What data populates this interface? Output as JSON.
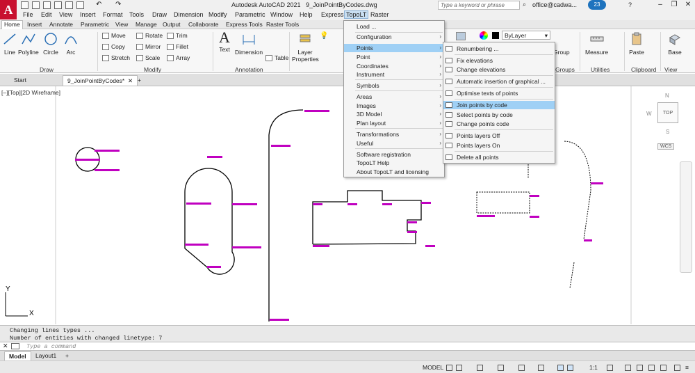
{
  "titlebar": {
    "app_title": "Autodesk AutoCAD 2021",
    "file_title": "9_JoinPointByCodes.dwg",
    "search_placeholder": "Type a keyword or phrase",
    "user": "office@cadwa...",
    "timer": "23",
    "logo_letter": "A"
  },
  "menubar": [
    "File",
    "Edit",
    "View",
    "Insert",
    "Format",
    "Tools",
    "Draw",
    "Dimension",
    "Modify",
    "Parametric",
    "Window",
    "Help",
    "Express",
    "TopoLT",
    "Raster"
  ],
  "ribbon_tabs": [
    "Home",
    "Insert",
    "Annotate",
    "Parametric",
    "View",
    "Manage",
    "Output",
    "Collaborate",
    "Express Tools",
    "Raster Tools"
  ],
  "ribbon": {
    "draw": {
      "title": "Draw",
      "buttons": [
        "Line",
        "Polyline",
        "Circle",
        "Arc"
      ]
    },
    "modify": {
      "title": "Modify",
      "buttons": [
        "Move",
        "Rotate",
        "Trim",
        "Copy",
        "Mirror",
        "Fillet",
        "Stretch",
        "Scale",
        "Array"
      ]
    },
    "annotation": {
      "title": "Annotation",
      "buttons": [
        "Text",
        "Dimension",
        "Table"
      ]
    },
    "layers": {
      "title": "Layer Properties",
      "bylayer": "ByLayer"
    },
    "groups": {
      "title": "Groups",
      "button": "Group"
    },
    "utilities": {
      "title": "Utilities",
      "button": "Measure"
    },
    "clipboard": {
      "title": "Clipboard",
      "button": "Paste"
    },
    "view": {
      "title": "View",
      "button": "Base"
    }
  },
  "doc_tabs": [
    "Start",
    "9_JoinPointByCodes*"
  ],
  "viewport_label": "[–][Top][2D Wireframe]",
  "viewcube": {
    "top": "TOP",
    "n": "N",
    "s": "S",
    "w": "W",
    "wcs": "WCS"
  },
  "command": {
    "history": [
      "Changing lines types ...",
      "Number of entities with changed linetype: 7"
    ],
    "placeholder": "Type a command"
  },
  "layout_tabs": [
    "Model",
    "Layout1"
  ],
  "status": {
    "model": "MODEL",
    "scale": "1:1"
  },
  "topolt_menu": {
    "items": [
      {
        "label": "Load ...",
        "arrow": false
      },
      {
        "label": "Configuration",
        "arrow": true
      },
      {
        "label": "Points",
        "arrow": true,
        "highlighted": true
      },
      {
        "label": "Point",
        "arrow": true
      },
      {
        "label": "Coordinates",
        "arrow": true
      },
      {
        "label": "Instrument",
        "arrow": true
      },
      {
        "label": "Symbols",
        "arrow": true
      },
      {
        "label": "Areas",
        "arrow": true
      },
      {
        "label": "Images",
        "arrow": true
      },
      {
        "label": "3D Model",
        "arrow": true
      },
      {
        "label": "Plan layout",
        "arrow": true
      },
      {
        "label": "Transformations",
        "arrow": true
      },
      {
        "label": "Useful",
        "arrow": true
      },
      {
        "label": "Software registration",
        "arrow": false
      },
      {
        "label": "TopoLT Help",
        "arrow": false
      },
      {
        "label": "About TopoLT and licensing",
        "arrow": false
      }
    ]
  },
  "points_menu": {
    "items": [
      {
        "label": "Renumbering ..."
      },
      {
        "label": "Fix elevations"
      },
      {
        "label": "Change elevations"
      },
      {
        "label": "Automatic insertion of graphical ..."
      },
      {
        "label": "Optimise texts of points"
      },
      {
        "label": "Join points by code",
        "highlighted": true
      },
      {
        "label": "Select points by code"
      },
      {
        "label": "Change points code"
      },
      {
        "label": "Points layers Off"
      },
      {
        "label": "Points layers On"
      },
      {
        "label": "Delete all points"
      }
    ]
  },
  "axis": {
    "x": "X",
    "y": "Y"
  },
  "colors": {
    "point_label": "#c000c0",
    "highlight": "#9fd0f5",
    "accent": "#c8102e"
  }
}
